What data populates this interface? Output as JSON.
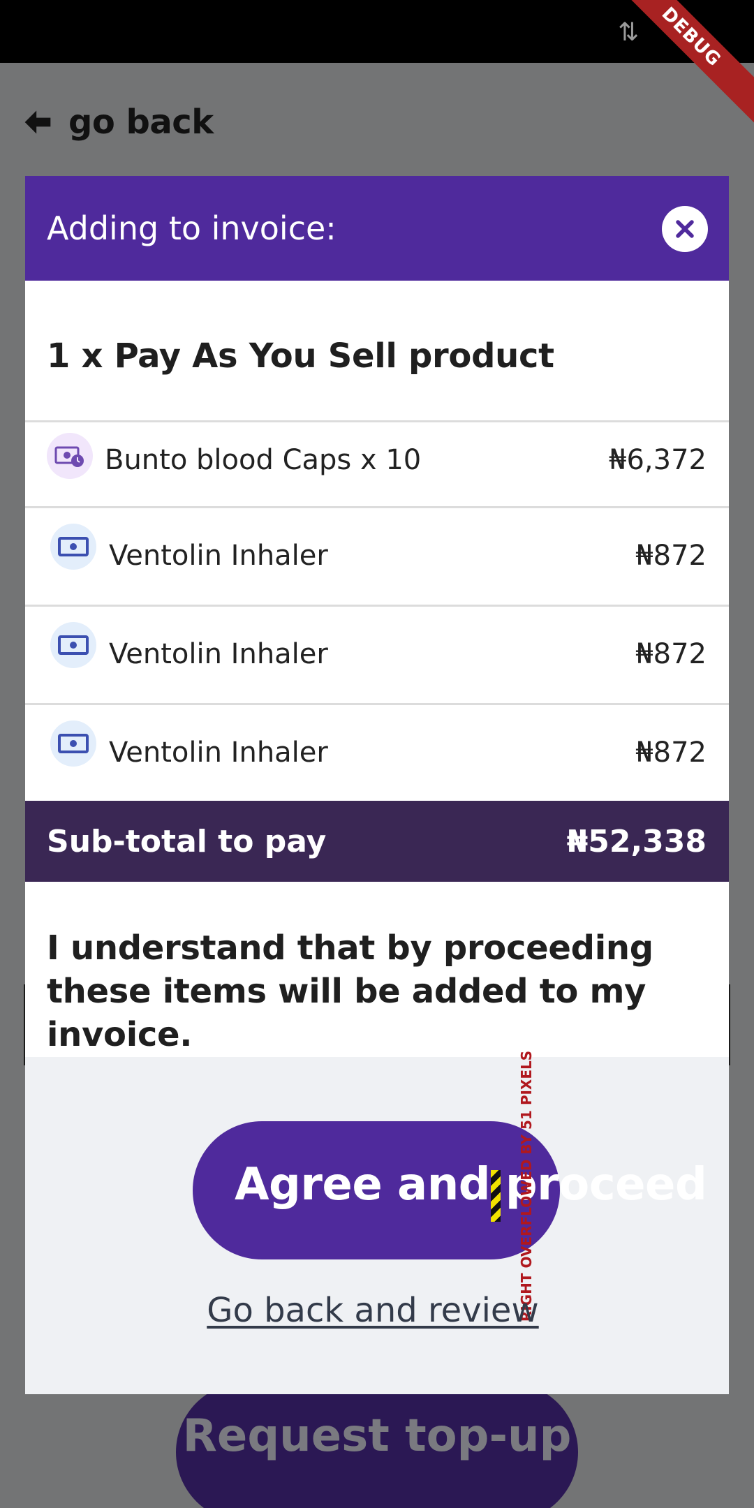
{
  "status_bar": {
    "signal_glyph": "⇅",
    "debug_label": "DEBUG"
  },
  "nav": {
    "back_label": "go back"
  },
  "dialog": {
    "title": "Adding to invoice:",
    "product_title": "1 x Pay As You Sell product",
    "items": [
      {
        "icon": "money-clock-icon",
        "name": "Bunto blood Caps x 10",
        "price": "₦6,372"
      },
      {
        "icon": "banknote-icon",
        "name": "Ventolin Inhaler",
        "price": "₦872"
      },
      {
        "icon": "banknote-icon",
        "name": "Ventolin Inhaler",
        "price": "₦872"
      },
      {
        "icon": "banknote-icon",
        "name": "Ventolin Inhaler",
        "price": "₦872"
      }
    ],
    "subtotal": {
      "label": "Sub-total to pay",
      "value": "₦52,338"
    },
    "consent_text": "I understand that by proceeding these items will be added to my invoice.",
    "agree_label": "Agree and proceed",
    "overflow_warning": "RIGHT OVERFLOWED BY 51 PIXELS",
    "review_label": "Go back and review"
  },
  "background": {
    "request_topup_label": "Request top-up"
  },
  "colors": {
    "header_purple": "#4f2a9c",
    "subtotal_bg": "#3a2754",
    "actions_bg": "#eff1f4",
    "overlay": "#737475"
  }
}
